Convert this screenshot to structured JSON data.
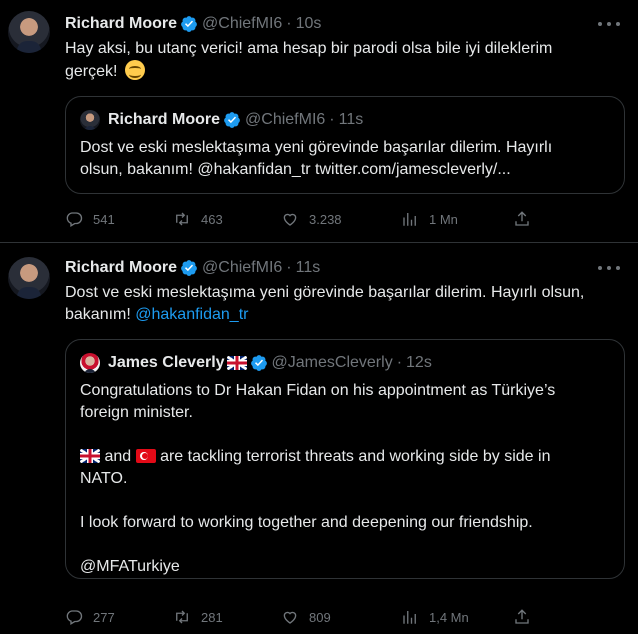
{
  "tweet1": {
    "author": {
      "name": "Richard Moore",
      "handle": "@ChiefMI6",
      "time": "10s"
    },
    "text_line1": "Hay aksi, bu utanç verici! ama hesap bir parodi olsa bile iyi dileklerim",
    "text_line2": "gerçek!",
    "quote": {
      "name": "Richard Moore",
      "handle": "@ChiefMI6",
      "time": "11s",
      "line1": "Dost ve eski meslektaşıma yeni görevinde başarılar dilerim.  Hayırlı",
      "line2": "olsun, bakanım! @hakanfidan_tr twitter.com/jamescleverly/..."
    },
    "stats": {
      "replies": "541",
      "retweets": "463",
      "likes": "3.238",
      "views": "1 Mn"
    }
  },
  "tweet2": {
    "author": {
      "name": "Richard Moore",
      "handle": "@ChiefMI6",
      "time": "11s"
    },
    "text_line1": "Dost ve eski meslektaşıma yeni görevinde başarılar dilerim.  Hayırlı olsun,",
    "text_line2_prefix": "bakanım!",
    "mention": "@hakanfidan_tr",
    "quote": {
      "name": "James Cleverly",
      "handle": "@JamesCleverly",
      "time": "12s",
      "p1_line1": "Congratulations to Dr Hakan Fidan on his appointment as Türkiye’s",
      "p1_line2": "foreign minister.",
      "p2_and": "and",
      "p2_line1_rest": "are tackling terrorist threats and working side by side in",
      "p2_line2": "NATO.",
      "p3": "I look forward to working together and deepening our friendship.",
      "p4": "@MFATurkiye"
    },
    "stats": {
      "replies": "277",
      "retweets": "281",
      "likes": "809",
      "views": "1,4 Mn"
    }
  },
  "separator": "·",
  "colors": {
    "background": "#000000",
    "text": "#e7e9ea",
    "muted": "#71767b",
    "link": "#1d9bf0",
    "verified": "#1d9bf0",
    "border": "#2f3336"
  },
  "icons": [
    "verified-icon",
    "more-icon",
    "reply-icon",
    "retweet-icon",
    "like-icon",
    "views-icon",
    "share-icon",
    "smile-emoji",
    "uk-flag-icon",
    "turkey-flag-icon"
  ]
}
